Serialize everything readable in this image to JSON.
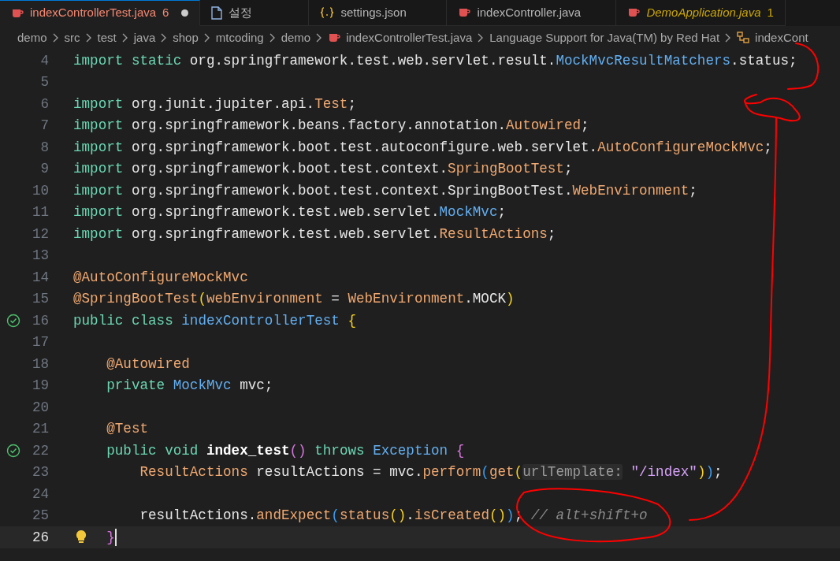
{
  "tabs": [
    {
      "label": "indexControllerTest.java",
      "kind": "java",
      "selected": true,
      "error": true,
      "warning": false,
      "problems": "6",
      "modified": true,
      "preview": false
    },
    {
      "label": "설정",
      "kind": "file",
      "selected": false,
      "error": false,
      "warning": false,
      "modified": false,
      "preview": false
    },
    {
      "label": "settings.json",
      "kind": "json",
      "selected": false,
      "error": false,
      "warning": false,
      "modified": false,
      "preview": false
    },
    {
      "label": "indexController.java",
      "kind": "java",
      "selected": false,
      "error": false,
      "warning": false,
      "modified": false,
      "preview": false
    },
    {
      "label": "DemoApplication.java",
      "kind": "java",
      "selected": false,
      "error": false,
      "warning": true,
      "problems": "1",
      "modified": false,
      "preview": true
    }
  ],
  "breadcrumb": [
    {
      "label": "demo"
    },
    {
      "label": "src"
    },
    {
      "label": "test"
    },
    {
      "label": "java"
    },
    {
      "label": "shop"
    },
    {
      "label": "mtcoding"
    },
    {
      "label": "demo"
    },
    {
      "label": "indexControllerTest.java",
      "kind": "java"
    },
    {
      "label": "Language Support for Java(TM) by Red Hat"
    },
    {
      "label": "indexCont",
      "kind": "symbol"
    }
  ],
  "lines": [
    {
      "number": "4",
      "test_passed": false,
      "lightbulb": false,
      "current": false,
      "tokens": [
        {
          "kind": "keyword",
          "text": "import static "
        },
        {
          "kind": "plain",
          "text": "org.springframework.test.web.servlet.result."
        },
        {
          "kind": "class",
          "text": "MockMvcResultMatchers"
        },
        {
          "kind": "plain",
          "text": ".status;"
        }
      ]
    },
    {
      "number": "5",
      "test_passed": false,
      "lightbulb": false,
      "current": false
    },
    {
      "number": "6",
      "test_passed": false,
      "lightbulb": false,
      "current": false,
      "tokens": [
        {
          "kind": "keyword",
          "text": "import "
        },
        {
          "kind": "plain",
          "text": "org.junit.jupiter.api."
        },
        {
          "kind": "type",
          "text": "Test"
        },
        {
          "kind": "plain",
          "text": ";"
        }
      ]
    },
    {
      "number": "7",
      "test_passed": false,
      "lightbulb": false,
      "current": false,
      "tokens": [
        {
          "kind": "keyword",
          "text": "import "
        },
        {
          "kind": "plain",
          "text": "org.springframework.beans.factory.annotation."
        },
        {
          "kind": "type",
          "text": "Autowired"
        },
        {
          "kind": "plain",
          "text": ";"
        }
      ]
    },
    {
      "number": "8",
      "test_passed": false,
      "lightbulb": false,
      "current": false,
      "tokens": [
        {
          "kind": "keyword",
          "text": "import "
        },
        {
          "kind": "plain",
          "text": "org.springframework.boot.test.autoconfigure.web.servlet."
        },
        {
          "kind": "type",
          "text": "AutoConfigureMockMvc"
        },
        {
          "kind": "plain",
          "text": ";"
        }
      ]
    },
    {
      "number": "9",
      "test_passed": false,
      "lightbulb": false,
      "current": false,
      "tokens": [
        {
          "kind": "keyword",
          "text": "import "
        },
        {
          "kind": "plain",
          "text": "org.springframework.boot.test.context."
        },
        {
          "kind": "type",
          "text": "SpringBootTest"
        },
        {
          "kind": "plain",
          "text": ";"
        }
      ]
    },
    {
      "number": "10",
      "test_passed": false,
      "lightbulb": false,
      "current": false,
      "tokens": [
        {
          "kind": "keyword",
          "text": "import "
        },
        {
          "kind": "plain",
          "text": "org.springframework.boot.test.context.SpringBootTest."
        },
        {
          "kind": "type",
          "text": "WebEnvironment"
        },
        {
          "kind": "plain",
          "text": ";"
        }
      ]
    },
    {
      "number": "11",
      "test_passed": false,
      "lightbulb": false,
      "current": false,
      "tokens": [
        {
          "kind": "keyword",
          "text": "import "
        },
        {
          "kind": "plain",
          "text": "org.springframework.test.web.servlet."
        },
        {
          "kind": "class",
          "text": "MockMvc"
        },
        {
          "kind": "plain",
          "text": ";"
        }
      ]
    },
    {
      "number": "12",
      "test_passed": false,
      "lightbulb": false,
      "current": false,
      "tokens": [
        {
          "kind": "keyword",
          "text": "import "
        },
        {
          "kind": "plain",
          "text": "org.springframework.test.web.servlet."
        },
        {
          "kind": "type",
          "text": "ResultActions"
        },
        {
          "kind": "plain",
          "text": ";"
        }
      ]
    },
    {
      "number": "13",
      "test_passed": false,
      "lightbulb": false,
      "current": false
    },
    {
      "number": "14",
      "test_passed": false,
      "lightbulb": false,
      "current": false,
      "tokens": [
        {
          "kind": "type",
          "text": "@AutoConfigureMockMvc"
        }
      ]
    },
    {
      "number": "15",
      "test_passed": false,
      "lightbulb": false,
      "current": false,
      "tokens": [
        {
          "kind": "type",
          "text": "@SpringBootTest"
        },
        {
          "kind": "bracket1",
          "text": "("
        },
        {
          "kind": "type",
          "text": "webEnvironment"
        },
        {
          "kind": "plain",
          "text": " = "
        },
        {
          "kind": "type",
          "text": "WebEnvironment"
        },
        {
          "kind": "plain",
          "text": ".MOCK"
        },
        {
          "kind": "bracket1",
          "text": ")"
        }
      ]
    },
    {
      "number": "16",
      "test_passed": true,
      "lightbulb": false,
      "current": false,
      "tokens": [
        {
          "kind": "keyword",
          "text": "public class "
        },
        {
          "kind": "class",
          "text": "indexControllerTest "
        },
        {
          "kind": "bracket1",
          "text": "{"
        }
      ]
    },
    {
      "number": "17",
      "test_passed": false,
      "lightbulb": false,
      "current": false
    },
    {
      "number": "18",
      "test_passed": false,
      "lightbulb": false,
      "current": false,
      "tokens": [
        {
          "kind": "type",
          "text": "    @Autowired"
        }
      ]
    },
    {
      "number": "19",
      "test_passed": false,
      "lightbulb": false,
      "current": false,
      "tokens": [
        {
          "kind": "keyword",
          "text": "    private "
        },
        {
          "kind": "class",
          "text": "MockMvc"
        },
        {
          "kind": "plain",
          "text": " mvc;"
        }
      ]
    },
    {
      "number": "20",
      "test_passed": false,
      "lightbulb": false,
      "current": false
    },
    {
      "number": "21",
      "test_passed": false,
      "lightbulb": false,
      "current": false,
      "tokens": [
        {
          "kind": "type",
          "text": "    @Test"
        }
      ]
    },
    {
      "number": "22",
      "test_passed": true,
      "lightbulb": false,
      "current": false,
      "tokens": [
        {
          "kind": "keyword",
          "text": "    public void "
        },
        {
          "kind": "method",
          "text": "index_test"
        },
        {
          "kind": "bracket2",
          "text": "()"
        },
        {
          "kind": "keyword",
          "text": " throws "
        },
        {
          "kind": "class",
          "text": "Exception "
        },
        {
          "kind": "match",
          "text": "{"
        }
      ]
    },
    {
      "number": "23",
      "test_passed": false,
      "lightbulb": false,
      "current": false,
      "tokens": [
        {
          "kind": "type",
          "text": "        ResultActions"
        },
        {
          "kind": "plain",
          "text": " resultActions = mvc."
        },
        {
          "kind": "type",
          "text": "perform"
        },
        {
          "kind": "bracket3",
          "text": "("
        },
        {
          "kind": "type",
          "text": "get"
        },
        {
          "kind": "bracket1",
          "text": "("
        },
        {
          "kind": "hint",
          "text": "urlTemplate:"
        },
        {
          "kind": "string",
          "text": " \"/index\""
        },
        {
          "kind": "bracket1",
          "text": ")"
        },
        {
          "kind": "bracket3",
          "text": ")"
        },
        {
          "kind": "plain",
          "text": ";"
        }
      ]
    },
    {
      "number": "24",
      "test_passed": false,
      "lightbulb": false,
      "current": false
    },
    {
      "number": "25",
      "test_passed": false,
      "lightbulb": false,
      "current": false,
      "tokens": [
        {
          "kind": "plain",
          "text": "        resultActions."
        },
        {
          "kind": "type",
          "text": "andExpect"
        },
        {
          "kind": "bracket3",
          "text": "("
        },
        {
          "kind": "type",
          "text": "status"
        },
        {
          "kind": "bracket1",
          "text": "()"
        },
        {
          "kind": "plain",
          "text": "."
        },
        {
          "kind": "type",
          "text": "isCreated"
        },
        {
          "kind": "bracket1",
          "text": "()"
        },
        {
          "kind": "bracket3",
          "text": ")"
        },
        {
          "kind": "plain",
          "text": ";"
        },
        {
          "kind": "comment",
          "text": " // alt+shift+o"
        }
      ]
    },
    {
      "number": "26",
      "test_passed": false,
      "lightbulb": true,
      "current": true,
      "tokens": [
        {
          "kind": "match",
          "text": "    }"
        }
      ]
    }
  ]
}
